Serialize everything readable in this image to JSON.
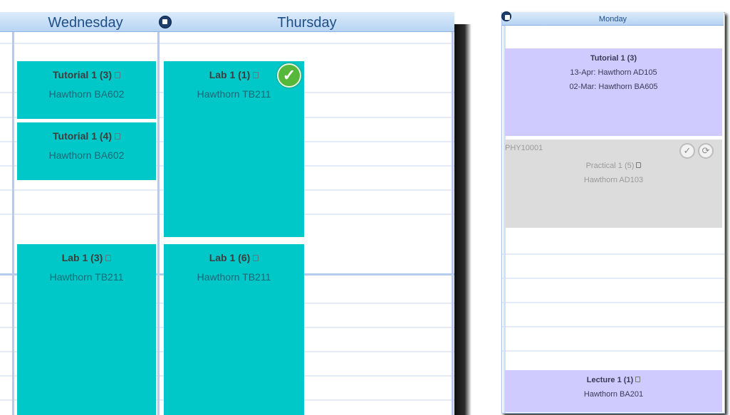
{
  "week": {
    "days": [
      {
        "label": "Wednesday"
      },
      {
        "label": "Thursday"
      }
    ],
    "events": {
      "wed_tut3": {
        "title": "Tutorial 1 (3)",
        "location": "Hawthorn BA602"
      },
      "wed_tut4": {
        "title": "Tutorial 1 (4)",
        "location": "Hawthorn BA602"
      },
      "wed_lab3": {
        "title": "Lab 1 (3)",
        "location": "Hawthorn TB211"
      },
      "thu_lab1": {
        "title": "Lab 1 (1)",
        "location": "Hawthorn TB211",
        "status_icon": "check-icon"
      },
      "thu_lab6": {
        "title": "Lab 1 (6)",
        "location": "Hawthorn TB211"
      }
    }
  },
  "monday": {
    "day_label": "Monday",
    "tutorial": {
      "title": "Tutorial 1 (3)",
      "line1": "13-Apr: Hawthorn AD105",
      "line2": "02-Mar: Hawthorn BA605"
    },
    "practical": {
      "code": "PHY10001",
      "title": "Practical 1 (5)",
      "location": "Hawthorn AD103"
    },
    "lecture": {
      "title": "Lecture 1 (1)",
      "location": "Hawthorn BA201"
    }
  },
  "colors": {
    "teal_event": "#00c8c8",
    "purple_event": "#cfcbff",
    "grey_event": "#dcdcdc",
    "header_blue": "#b7d4f3"
  }
}
